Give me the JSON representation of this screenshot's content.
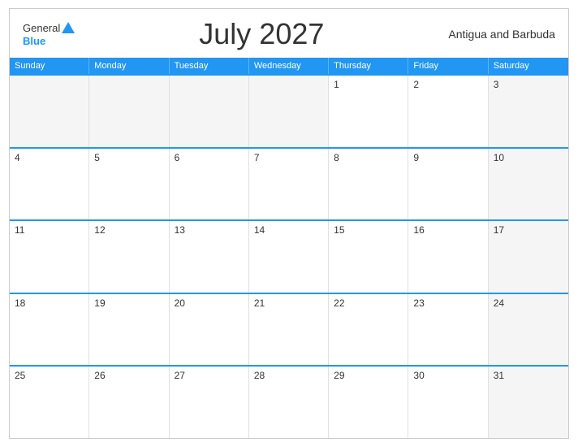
{
  "header": {
    "title": "July 2027",
    "country": "Antigua and Barbuda",
    "logo": {
      "general": "General",
      "blue": "Blue"
    }
  },
  "days_of_week": [
    "Sunday",
    "Monday",
    "Tuesday",
    "Wednesday",
    "Thursday",
    "Friday",
    "Saturday"
  ],
  "weeks": [
    [
      {
        "day": "",
        "shaded": true
      },
      {
        "day": "",
        "shaded": true
      },
      {
        "day": "",
        "shaded": true
      },
      {
        "day": "",
        "shaded": true
      },
      {
        "day": "1",
        "shaded": false
      },
      {
        "day": "2",
        "shaded": false
      },
      {
        "day": "3",
        "shaded": true
      }
    ],
    [
      {
        "day": "4",
        "shaded": false
      },
      {
        "day": "5",
        "shaded": false
      },
      {
        "day": "6",
        "shaded": false
      },
      {
        "day": "7",
        "shaded": false
      },
      {
        "day": "8",
        "shaded": false
      },
      {
        "day": "9",
        "shaded": false
      },
      {
        "day": "10",
        "shaded": true
      }
    ],
    [
      {
        "day": "11",
        "shaded": false
      },
      {
        "day": "12",
        "shaded": false
      },
      {
        "day": "13",
        "shaded": false
      },
      {
        "day": "14",
        "shaded": false
      },
      {
        "day": "15",
        "shaded": false
      },
      {
        "day": "16",
        "shaded": false
      },
      {
        "day": "17",
        "shaded": true
      }
    ],
    [
      {
        "day": "18",
        "shaded": false
      },
      {
        "day": "19",
        "shaded": false
      },
      {
        "day": "20",
        "shaded": false
      },
      {
        "day": "21",
        "shaded": false
      },
      {
        "day": "22",
        "shaded": false
      },
      {
        "day": "23",
        "shaded": false
      },
      {
        "day": "24",
        "shaded": true
      }
    ],
    [
      {
        "day": "25",
        "shaded": false
      },
      {
        "day": "26",
        "shaded": false
      },
      {
        "day": "27",
        "shaded": false
      },
      {
        "day": "28",
        "shaded": false
      },
      {
        "day": "29",
        "shaded": false
      },
      {
        "day": "30",
        "shaded": false
      },
      {
        "day": "31",
        "shaded": true
      }
    ]
  ]
}
